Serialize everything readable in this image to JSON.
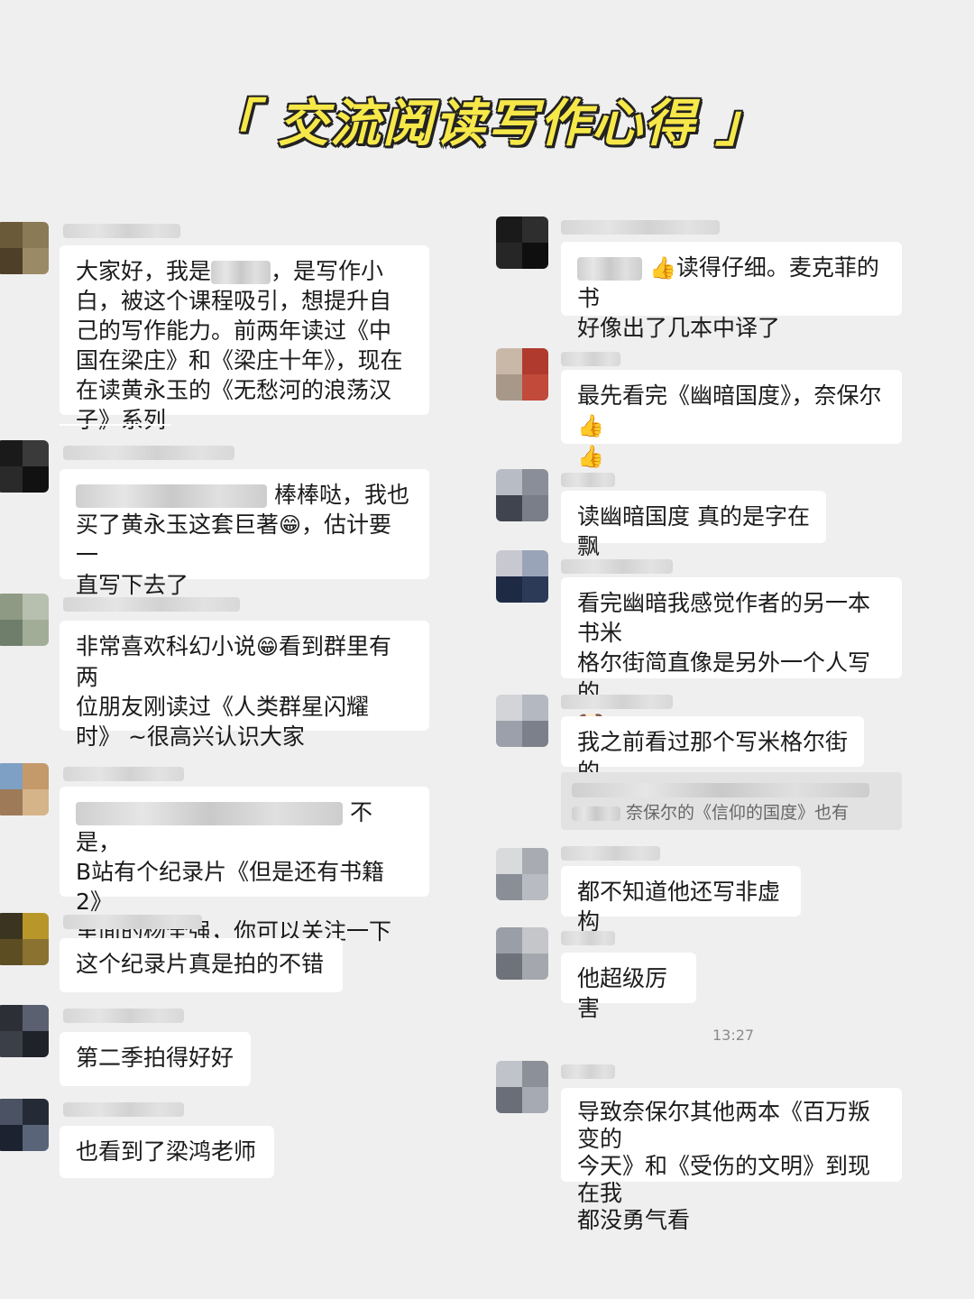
{
  "header": {
    "title": "「 交流阅读写作心得 」"
  },
  "emoji": {
    "thumbs": "👍",
    "grin": "😁",
    "doge": "🐶"
  },
  "left": {
    "m1": {
      "line1": "大家好，我是",
      "line1b": "，是写作小白，",
      "rest": "被这个课程吸引，想提升自己的写作能力。前两年读过《中国在梁庄》和《梁庄十年》，现在在读黄永玉的《无愁河的浪荡汉子》系列"
    },
    "m2": {
      "a": "棒棒哒，我也",
      "b": "买了黄永玉这套巨著",
      "c": "，估计要一",
      "d": "直写下去了"
    },
    "m3": {
      "a": "非常喜欢科幻小说",
      "b": "看到群里有两",
      "c": "位朋友刚读过《人类群星闪耀",
      "d": "时》 ~很高兴认识大家"
    },
    "m4": {
      "a": "不是，",
      "b": "B站有个纪录片《但是还有书籍 2》",
      "c": "里面的杨全强，你可以关注一下"
    },
    "m5": {
      "text": "这个纪录片真是拍的不错"
    },
    "m6": {
      "text": "第二季拍得好好"
    },
    "m7": {
      "text": "也看到了梁鸿老师"
    }
  },
  "right": {
    "m1": {
      "a": "读得仔细。麦克菲的书",
      "b": "好像出了几本中译了"
    },
    "m2": {
      "a": "最先看完《幽暗国度》，奈保尔"
    },
    "m3": {
      "text": "读幽暗国度 真的是字在飘"
    },
    "m4": {
      "a": "看完幽暗我感觉作者的另一本书米",
      "b": "格尔街简直像是另外一个人写的"
    },
    "m5": {
      "text": "我之前看过那个写米格尔街的",
      "quote": "奈保尔的《信仰的国度》也有"
    },
    "m6": {
      "text": "都不知道他还写非虚构"
    },
    "m7": {
      "text": "他超级厉害"
    },
    "time": "13:27",
    "m8": {
      "a": "导致奈保尔其他两本《百万叛变的",
      "b": "今天》和《受伤的文明》到现在我",
      "c": "都没勇气看"
    }
  },
  "colors": {
    "background": "#efefef",
    "bubble": "#ffffff",
    "title_fill": "#f7e84a"
  }
}
